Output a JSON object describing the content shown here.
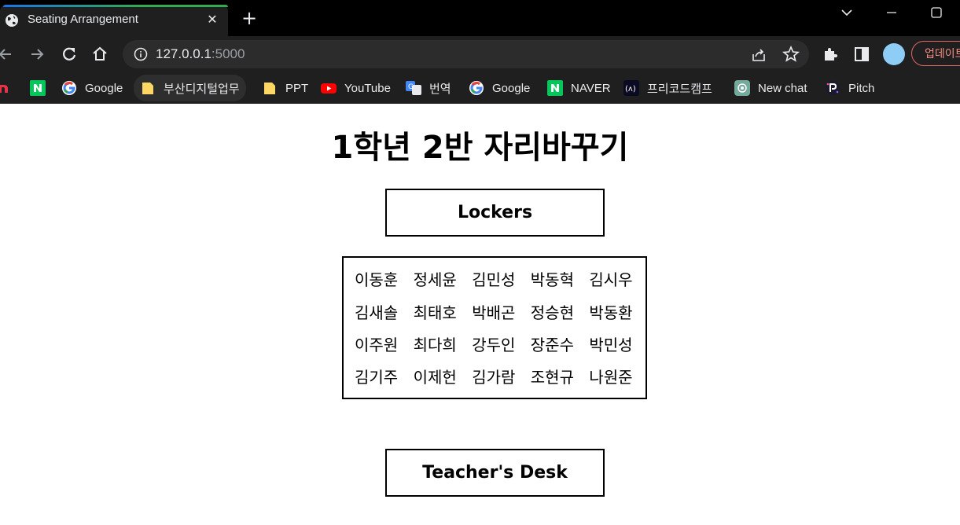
{
  "tab": {
    "title": "Seating Arrangement",
    "close": "✕",
    "new_tab": "+"
  },
  "omnibox": {
    "host": "127.0.0.1",
    "port": ":5000"
  },
  "toolbar": {
    "update_label": "업데이트"
  },
  "bookmarks": [
    {
      "label": "Google",
      "icon": "google-icon"
    },
    {
      "label": "부산디지털업무",
      "icon": "folder-icon"
    },
    {
      "label": "PPT",
      "icon": "folder-icon"
    },
    {
      "label": "YouTube",
      "icon": "youtube-icon"
    },
    {
      "label": "번역",
      "icon": "translate-icon"
    },
    {
      "label": "Google",
      "icon": "google-icon"
    },
    {
      "label": "NAVER",
      "icon": "naver-icon"
    },
    {
      "label": "프리코드캠프",
      "icon": "freecodecamp-icon"
    },
    {
      "label": "New chat",
      "icon": "chatgpt-icon"
    },
    {
      "label": "Pitch",
      "icon": "pitch-icon"
    }
  ],
  "page": {
    "title": "1학년 2반 자리바꾸기",
    "lockers": "Lockers",
    "teacher_desk": "Teacher's Desk",
    "seats": [
      [
        "이동훈",
        "정세윤",
        "김민성",
        "박동혁",
        "김시우"
      ],
      [
        "김새솔",
        "최태호",
        "박배곤",
        "정승현",
        "박동환"
      ],
      [
        "이주원",
        "최다희",
        "강두인",
        "장준수",
        "박민성"
      ],
      [
        "김기주",
        "이제헌",
        "김가람",
        "조현규",
        "나원준"
      ]
    ]
  },
  "colors": {
    "chrome_bg": "#1f1f1f",
    "tabstrip_bg": "#000000",
    "text_light": "#e8eaed",
    "update_red": "#f28b82"
  }
}
